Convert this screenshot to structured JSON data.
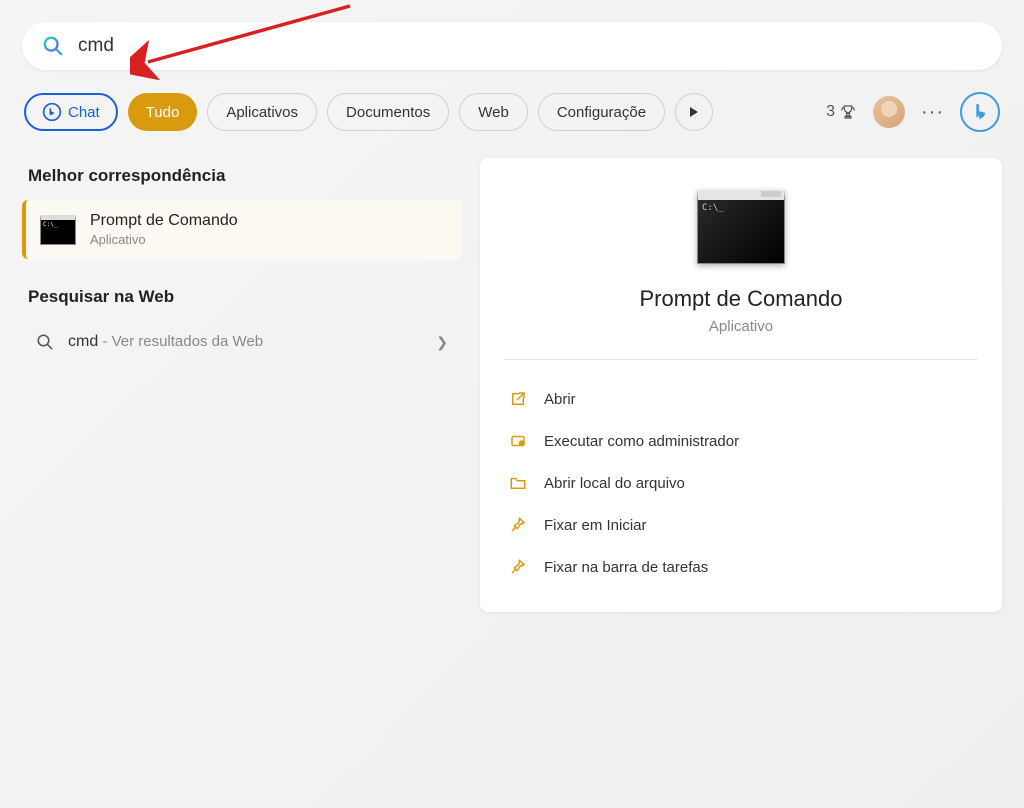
{
  "search": {
    "value": "cmd"
  },
  "tabs": {
    "chat": "Chat",
    "all": "Tudo",
    "apps": "Aplicativos",
    "documents": "Documentos",
    "web": "Web",
    "settings": "Configuraçõe"
  },
  "points_count": "3",
  "left": {
    "best_match_heading": "Melhor correspondência",
    "best_match": {
      "title": "Prompt de Comando",
      "subtitle": "Aplicativo"
    },
    "web_heading": "Pesquisar na Web",
    "web_item": {
      "query": "cmd",
      "hint": " - Ver resultados da Web"
    }
  },
  "preview": {
    "title": "Prompt de Comando",
    "subtitle": "Aplicativo",
    "actions": {
      "open": "Abrir",
      "run_admin": "Executar como administrador",
      "open_location": "Abrir local do arquivo",
      "pin_start": "Fixar em Iniciar",
      "pin_taskbar": "Fixar na barra de tarefas"
    }
  }
}
